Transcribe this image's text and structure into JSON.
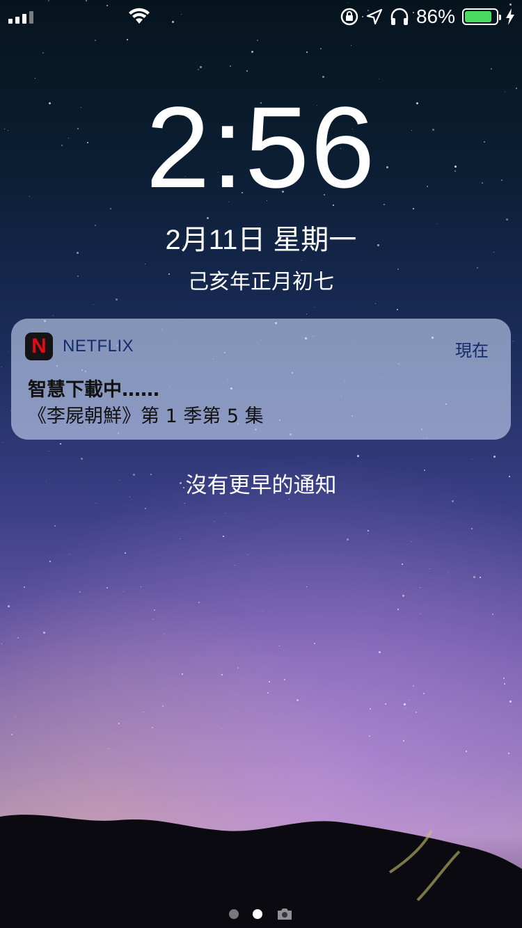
{
  "status_bar": {
    "battery_percent": "86%",
    "battery_level": 0.86,
    "icons": [
      "signal-icon",
      "wifi-icon",
      "orientation-lock-icon",
      "location-icon",
      "headphones-icon",
      "battery-icon",
      "charging-icon"
    ],
    "battery_color": "#4cd964"
  },
  "lockscreen": {
    "time": "2:56",
    "date": "2月11日 星期一",
    "lunar_date": "己亥年正月初七"
  },
  "notification": {
    "app_name": "NETFLIX",
    "app_icon_letter": "N",
    "time": "現在",
    "title": "智慧下載中……",
    "body": "《李屍朝鮮》第 1 季第 5 集",
    "brand_color": "#e50914"
  },
  "no_older_notifications": "沒有更早的通知",
  "page_indicator": {
    "pages": 2,
    "active_index": 1,
    "icons": [
      "camera-icon"
    ]
  }
}
